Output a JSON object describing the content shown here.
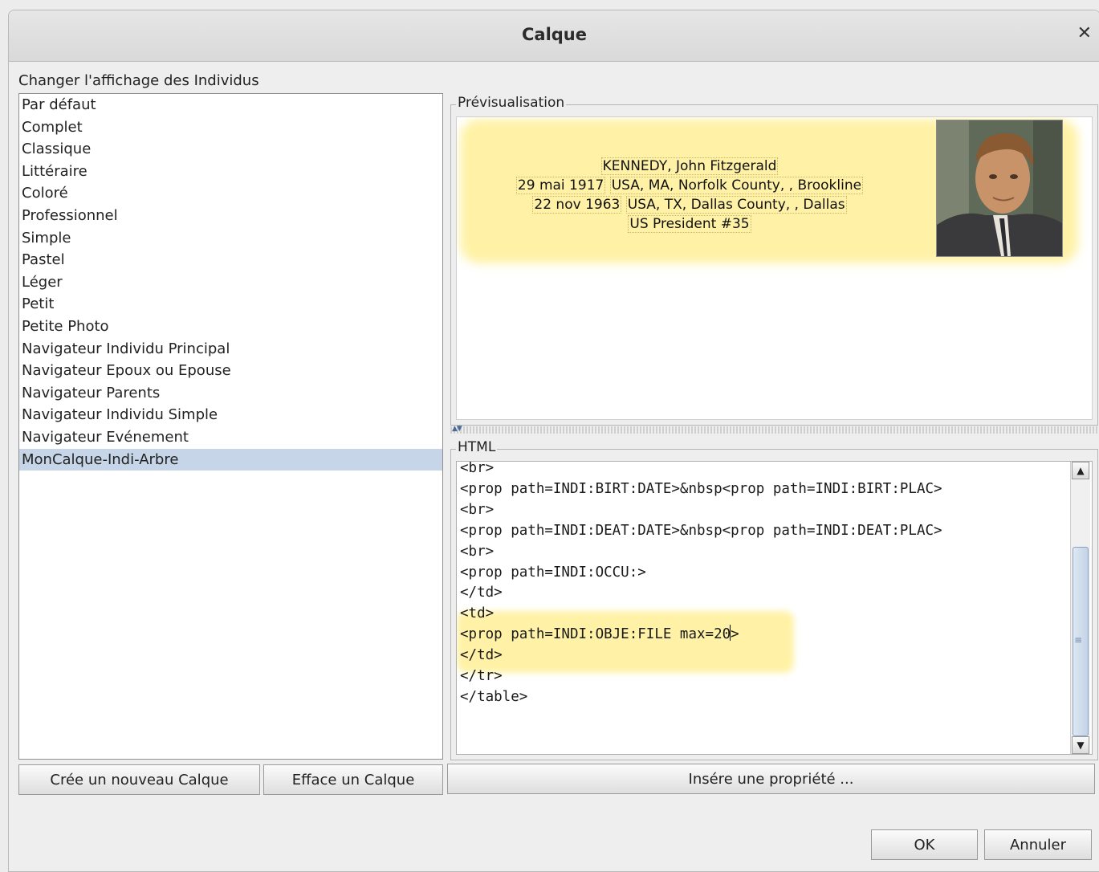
{
  "window": {
    "title": "Calque",
    "close_icon": "close-icon"
  },
  "left": {
    "section_label": "Changer l'affichage des Individus",
    "items": [
      {
        "label": "Par défaut"
      },
      {
        "label": "Complet"
      },
      {
        "label": "Classique"
      },
      {
        "label": "Littéraire"
      },
      {
        "label": "Coloré"
      },
      {
        "label": "Professionnel"
      },
      {
        "label": "Simple"
      },
      {
        "label": "Pastel"
      },
      {
        "label": "Léger"
      },
      {
        "label": "Petit"
      },
      {
        "label": "Petite Photo"
      },
      {
        "label": "Navigateur Individu Principal"
      },
      {
        "label": "Navigateur Epoux ou Epouse"
      },
      {
        "label": "Navigateur Parents"
      },
      {
        "label": "Navigateur Individu Simple"
      },
      {
        "label": "Navigateur Evénement"
      },
      {
        "label": "MonCalque-Indi-Arbre"
      }
    ],
    "selected_label": "MonCalque-Indi-Arbre",
    "new_button": "Crée un nouveau Calque",
    "delete_button": "Efface un Calque"
  },
  "preview": {
    "legend": "Prévisualisation",
    "name": "KENNEDY, John Fitzgerald",
    "birth_date": "29 mai 1917",
    "birth_place": "USA, MA, Norfolk County, , Brookline",
    "death_date": "22 nov 1963",
    "death_place": "USA, TX, Dallas County, , Dallas",
    "occupation": "US President #35"
  },
  "html_editor": {
    "legend": "HTML",
    "lines": [
      "<br>",
      "<prop path=INDI:BIRT:DATE>&nbsp<prop path=INDI:BIRT:PLAC>",
      "<br>",
      "<prop path=INDI:DEAT:DATE>&nbsp<prop path=INDI:DEAT:PLAC>",
      "<br>",
      "<prop path=INDI:OCCU:>",
      "</td>",
      "<td>",
      "<prop path=INDI:OBJE:FILE max=20",
      "</td>",
      "</tr>",
      "</table>"
    ],
    "caret_line_tail": ">",
    "insert_button": "Insére une propriété ..."
  },
  "footer": {
    "ok_button": "OK",
    "cancel_button": "Annuler"
  }
}
